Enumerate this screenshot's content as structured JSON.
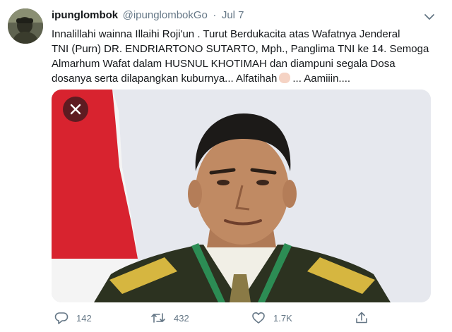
{
  "user": {
    "display_name": "ipunglombok",
    "handle": "@ipunglombokGo",
    "separator": "·",
    "date": "Jul 7"
  },
  "tweet": {
    "lines": [
      "Innalillahi wainna Illaihi Roji'un .  Turut Berdukacita atas Wafatnya Jenderal",
      "TNI (Purn) DR. ENDRIARTONO SUTARTO, Mph., Panglima TNI ke 14. Semoga",
      "Almarhum Wafat dalam  HUSNUL KHOTIMAH dan diampuni segala Dosa",
      "dosanya serta dilapangkan kuburnya... Alfatihah",
      "... Aamiiin...."
    ],
    "emoji": "folded-hands-emoji"
  },
  "media": {
    "close_icon": "close-icon",
    "flag_colors": {
      "red": "#d8232f",
      "white": "#f4f4f4"
    },
    "background_color": "#e6e8ee"
  },
  "actions": {
    "reply_count": "142",
    "retweet_count": "432",
    "like_count": "1.7K"
  },
  "colors": {
    "primary_text": "#14171a",
    "secondary_text": "#657786"
  }
}
